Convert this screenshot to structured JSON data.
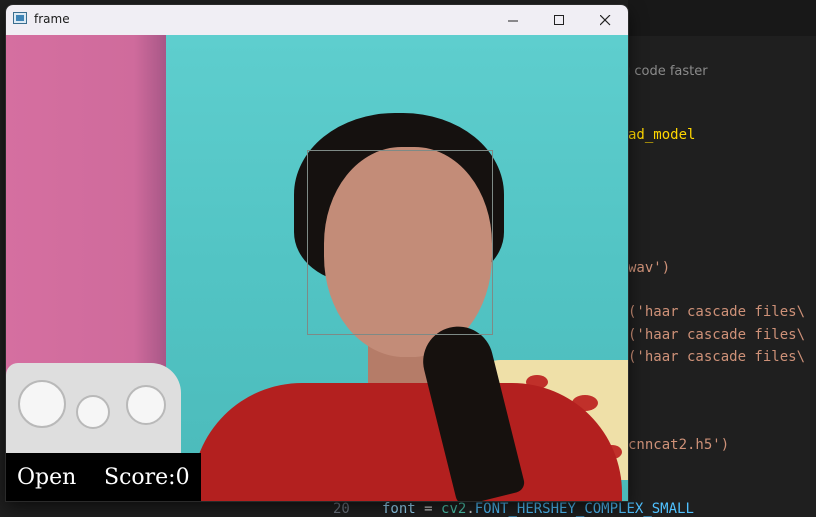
{
  "editor": {
    "hint": "u code faster",
    "lines": [
      {
        "text": "ad_model",
        "color": "#dcdcaa"
      },
      {
        "text": "wav')",
        "color": "#ce9178"
      },
      {
        "text": "('haar cascade files\\",
        "color": "#ce9178"
      },
      {
        "text": "('haar cascade files\\",
        "color": "#ce9178"
      },
      {
        "text": "('haar cascade files\\",
        "color": "#ce9178"
      },
      {
        "text": "cnncat2.h5')",
        "color": "#ce9178"
      }
    ],
    "line_number": "20",
    "bottom_code": {
      "var": "font",
      "op": " = ",
      "module": "cv2",
      "dot": ".",
      "const": "FONT_HERSHEY_COMPLEX_SMALL"
    }
  },
  "window": {
    "title": "frame",
    "minimize_glyph": "—",
    "maximize_glyph": "☐",
    "close_glyph": "✕",
    "icon": "app-window-icon"
  },
  "overlay": {
    "state_label": "Open",
    "score_label": "Score:0"
  },
  "colors": {
    "wall": "#5ecece",
    "face_box": "#7e8a86",
    "status_bg": "#000000",
    "status_text": "#ffffff"
  }
}
